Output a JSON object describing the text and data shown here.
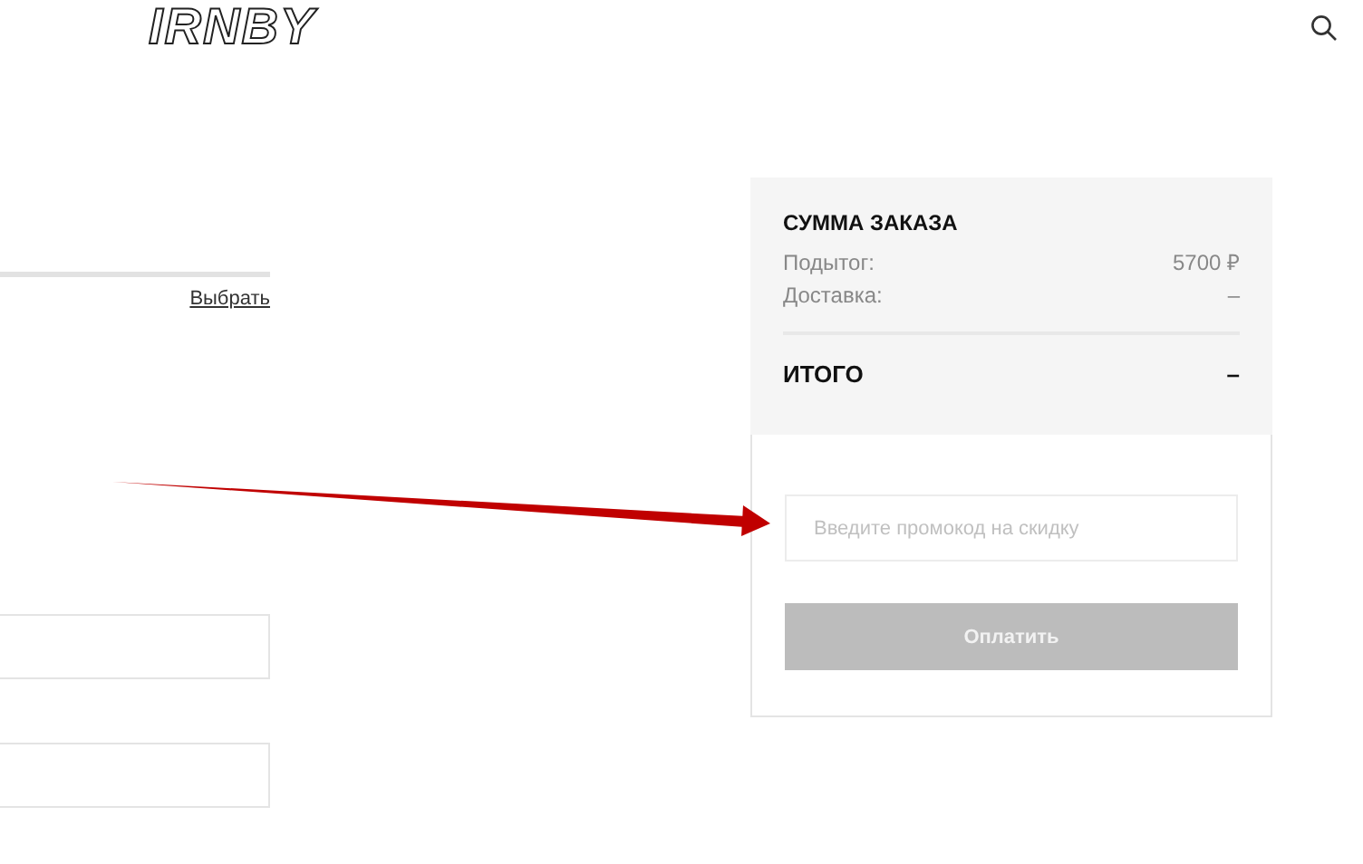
{
  "header": {
    "logo": "IRNBY"
  },
  "delivery": {
    "link": "Выбрать"
  },
  "fields": [
    {
      "kind": "text"
    },
    {
      "kind": "text"
    }
  ],
  "summary": {
    "title": "СУММА ЗАКАЗА",
    "rows": [
      {
        "label": "Подытог:",
        "value": "5700 ₽"
      },
      {
        "label": "Доставка:",
        "value": "–"
      }
    ],
    "total_label": "ИТОГО",
    "total_value": "–",
    "promo": {
      "placeholder": "Введите промокод на скидку"
    },
    "pay_button": {
      "label": "Оплатить",
      "disabled": true
    }
  }
}
